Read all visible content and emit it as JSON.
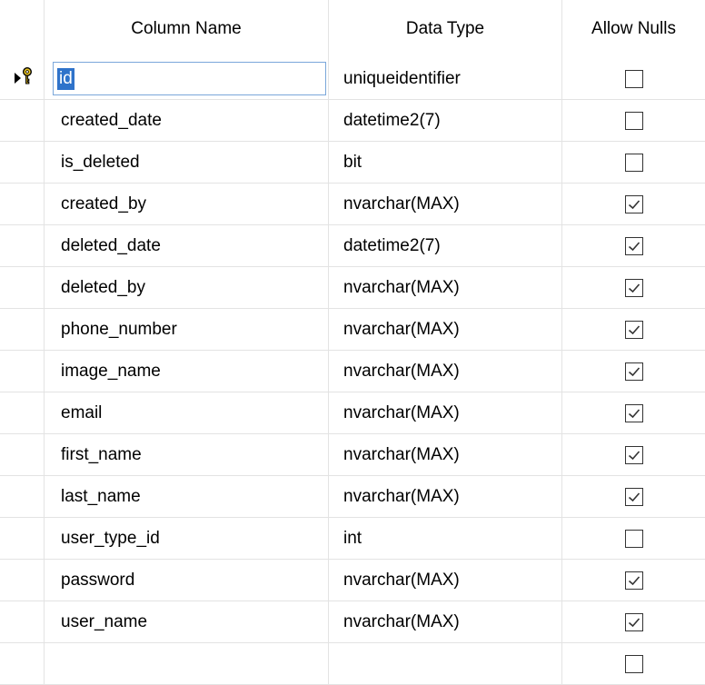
{
  "headers": {
    "column_name": "Column Name",
    "data_type": "Data Type",
    "allow_nulls": "Allow Nulls"
  },
  "icons": {
    "row_indicator": "current-row-arrow-icon",
    "primary_key": "primary-key-icon"
  },
  "colors": {
    "selection": "#2f73ca",
    "focus_border": "#7aa7da",
    "key_yellow": "#e8c21f"
  },
  "rows": [
    {
      "name": "id",
      "type": "uniqueidentifier",
      "allow_nulls": false
    },
    {
      "name": "created_date",
      "type": "datetime2(7)",
      "allow_nulls": false
    },
    {
      "name": "is_deleted",
      "type": "bit",
      "allow_nulls": false
    },
    {
      "name": "created_by",
      "type": "nvarchar(MAX)",
      "allow_nulls": true
    },
    {
      "name": "deleted_date",
      "type": "datetime2(7)",
      "allow_nulls": true
    },
    {
      "name": "deleted_by",
      "type": "nvarchar(MAX)",
      "allow_nulls": true
    },
    {
      "name": "phone_number",
      "type": "nvarchar(MAX)",
      "allow_nulls": true
    },
    {
      "name": "image_name",
      "type": "nvarchar(MAX)",
      "allow_nulls": true
    },
    {
      "name": "email",
      "type": "nvarchar(MAX)",
      "allow_nulls": true
    },
    {
      "name": "first_name",
      "type": "nvarchar(MAX)",
      "allow_nulls": true
    },
    {
      "name": "last_name",
      "type": "nvarchar(MAX)",
      "allow_nulls": true
    },
    {
      "name": "user_type_id",
      "type": "int",
      "allow_nulls": false
    },
    {
      "name": "password",
      "type": "nvarchar(MAX)",
      "allow_nulls": true
    },
    {
      "name": "user_name",
      "type": "nvarchar(MAX)",
      "allow_nulls": true
    },
    {
      "name": "",
      "type": "",
      "allow_nulls": false
    }
  ]
}
